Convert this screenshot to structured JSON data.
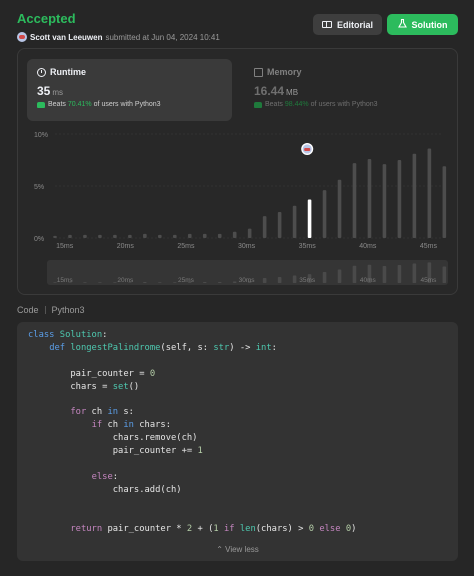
{
  "submission": {
    "status": "Accepted",
    "user": "Scott van Leeuwen",
    "submitted_text": "submitted at Jun 04, 2024 10:41"
  },
  "buttons": {
    "editorial": "Editorial",
    "solution": "Solution"
  },
  "runtime": {
    "title": "Runtime",
    "value": "35",
    "unit": "ms",
    "beats_prefix": "Beats",
    "beats_pct": "70.41%",
    "beats_suffix": "of users with Python3"
  },
  "memory": {
    "title": "Memory",
    "value": "16.44",
    "unit": "MB",
    "beats_prefix": "Beats",
    "beats_pct": "98.44%",
    "beats_suffix": "of users with Python3"
  },
  "chart_data": {
    "type": "bar",
    "y_ticks": [
      "10%",
      "5%",
      "0%"
    ],
    "ylim": [
      0,
      10
    ],
    "x_tick_labels": [
      "15ms",
      "20ms",
      "25ms",
      "30ms",
      "35ms",
      "40ms",
      "45ms"
    ],
    "x_tick_values": [
      15,
      20,
      25,
      30,
      35,
      40,
      45
    ],
    "x_start": 14.2,
    "x_step": 1.235,
    "values": [
      0.2,
      0.3,
      0.3,
      0.3,
      0.3,
      0.3,
      0.4,
      0.3,
      0.3,
      0.4,
      0.4,
      0.4,
      0.6,
      0.9,
      2.1,
      2.5,
      3.1,
      3.7,
      4.6,
      5.6,
      7.2,
      7.6,
      7.1,
      7.5,
      8.1,
      8.6,
      6.9,
      5.6,
      5.1,
      3.5,
      2.4
    ],
    "highlight_x": 35,
    "highlight_value": 7.6,
    "navigator_labels": [
      "15ms",
      "20ms",
      "25ms",
      "30ms",
      "35ms",
      "40ms",
      "45ms"
    ],
    "colors": {
      "bar": "#4d4d4d",
      "highlight": "#ffffff",
      "grid": "#3c3c3c",
      "navigator_bg": "#353535"
    }
  },
  "code": {
    "label": "Code",
    "language": "Python3",
    "view_less": "View less"
  }
}
